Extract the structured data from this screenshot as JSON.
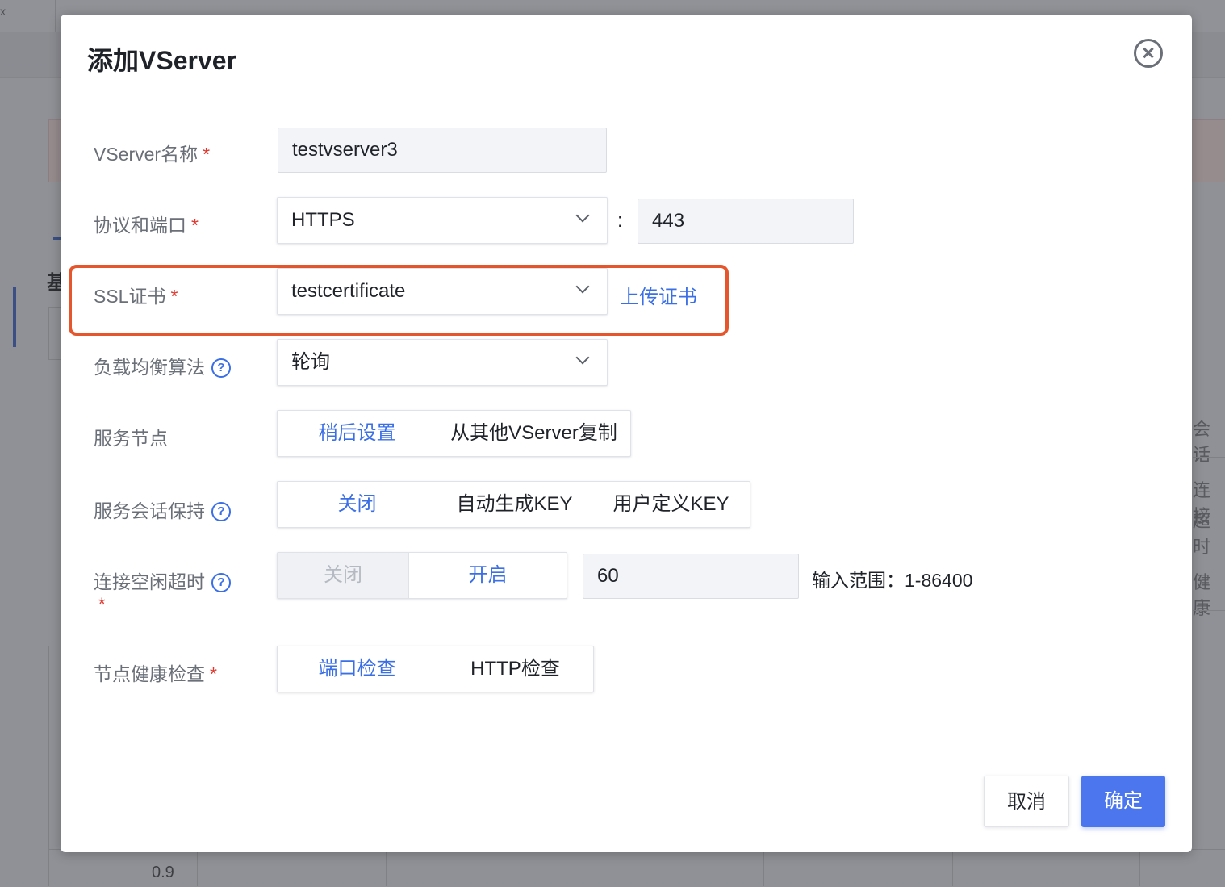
{
  "background": {
    "corner_text": "x",
    "left_heading": "基",
    "right_texts": [
      "会话",
      "连接",
      "超时",
      "健康"
    ],
    "axis_label": "0.9"
  },
  "modal": {
    "title": "添加VServer",
    "close_icon": "close-circle-icon"
  },
  "form": {
    "name": {
      "label": "VServer名称",
      "required": "*",
      "value": "testvserver3"
    },
    "protocol": {
      "label": "协议和端口",
      "required": "*",
      "value": "HTTPS",
      "separator": ":",
      "port": "443"
    },
    "ssl": {
      "label": "SSL证书",
      "required": "*",
      "value": "testcertificate",
      "upload_link": "上传证书"
    },
    "lb": {
      "label": "负载均衡算法",
      "help": "?",
      "value": "轮询"
    },
    "nodes": {
      "label": "服务节点",
      "options": [
        "稍后设置",
        "从其他VServer复制"
      ],
      "selected": "稍后设置"
    },
    "session": {
      "label": "服务会话保持",
      "help": "?",
      "options": [
        "关闭",
        "自动生成KEY",
        "用户定义KEY"
      ],
      "selected": "关闭"
    },
    "idle": {
      "label": "连接空闲超时",
      "help": "?",
      "required": "*",
      "options": [
        "关闭",
        "开启"
      ],
      "selected": "开启",
      "value": "60",
      "hint": "输入范围：1-86400"
    },
    "health": {
      "label": "节点健康检查",
      "required": "*",
      "options": [
        "端口检查",
        "HTTP检查"
      ],
      "selected": "端口检查"
    }
  },
  "footer": {
    "cancel_label": "取消",
    "ok_label": "确定"
  },
  "colors": {
    "accent": "#4b76ee",
    "link": "#3b6fe6",
    "required": "#e0382f",
    "highlight": "#e5562d"
  }
}
